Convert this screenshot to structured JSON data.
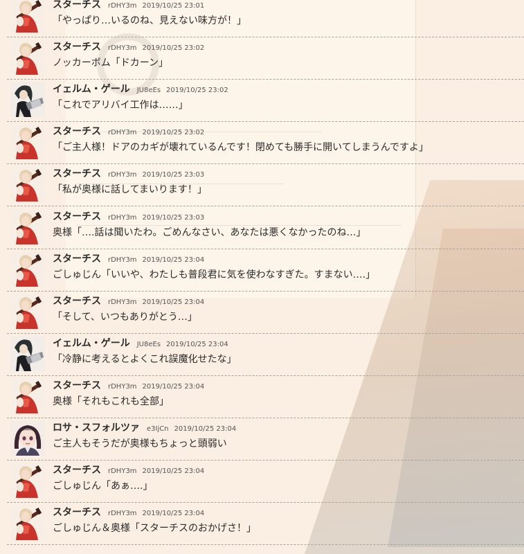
{
  "colors": {
    "background": "#fbeee2",
    "divider": "#a8a39c",
    "text": "#2b2b2b"
  },
  "avatar_icons": {
    "starches": "red-dress-girl-with-rifle-avatar",
    "ielm": "dark-haired-girl-with-gun-avatar",
    "rosa": "brown-haired-girl-avatar"
  },
  "messages": [
    {
      "speaker": "スターチス",
      "uid": "rDHY3m",
      "time": "2019/10/25 23:01",
      "text": "「やっぱり…いるのね、見えない味方が！」",
      "avatar": "starches"
    },
    {
      "speaker": "スターチス",
      "uid": "rDHY3m",
      "time": "2019/10/25 23:02",
      "text": "ノッカーボム「ドカーン」",
      "avatar": "starches"
    },
    {
      "speaker": "イェルム・ゲール",
      "uid": "JU8eEs",
      "time": "2019/10/25 23:02",
      "text": "「これでアリバイ工作は……」",
      "avatar": "ielm"
    },
    {
      "speaker": "スターチス",
      "uid": "rDHY3m",
      "time": "2019/10/25 23:02",
      "text": "「ご主人様！ドアのカギが壊れているんです！閉めても勝手に開いてしまうんですよ」",
      "avatar": "starches"
    },
    {
      "speaker": "スターチス",
      "uid": "rDHY3m",
      "time": "2019/10/25 23:03",
      "text": "「私が奥様に話してまいります！」",
      "avatar": "starches"
    },
    {
      "speaker": "スターチス",
      "uid": "rDHY3m",
      "time": "2019/10/25 23:03",
      "text": "奥様「….話は聞いたわ。ごめんなさい、あなたは悪くなかったのね…」",
      "avatar": "starches"
    },
    {
      "speaker": "スターチス",
      "uid": "rDHY3m",
      "time": "2019/10/25 23:04",
      "text": "ごしゅじん「いいや、わたしも普段君に気を使わなすぎた。すまない….」",
      "avatar": "starches"
    },
    {
      "speaker": "スターチス",
      "uid": "rDHY3m",
      "time": "2019/10/25 23:04",
      "text": "「そして、いつもありがとう…」",
      "avatar": "starches"
    },
    {
      "speaker": "イェルム・ゲール",
      "uid": "JU8eEs",
      "time": "2019/10/25 23:04",
      "text": "「冷静に考えるとよくこれ誤魔化せたな」",
      "avatar": "ielm"
    },
    {
      "speaker": "スターチス",
      "uid": "rDHY3m",
      "time": "2019/10/25 23:04",
      "text": "奥様「それもこれも全部」",
      "avatar": "starches"
    },
    {
      "speaker": "ロサ・スフォルツァ",
      "uid": "e3IjCn",
      "time": "2019/10/25 23:04",
      "text": "ご主人もそうだが奥様もちょっと頭弱い",
      "avatar": "rosa"
    },
    {
      "speaker": "スターチス",
      "uid": "rDHY3m",
      "time": "2019/10/25 23:04",
      "text": "ごしゅじん「あぁ….」",
      "avatar": "starches"
    },
    {
      "speaker": "スターチス",
      "uid": "rDHY3m",
      "time": "2019/10/25 23:04",
      "text": "ごしゅじん＆奥様「スターチスのおかげさ！」",
      "avatar": "starches"
    }
  ]
}
